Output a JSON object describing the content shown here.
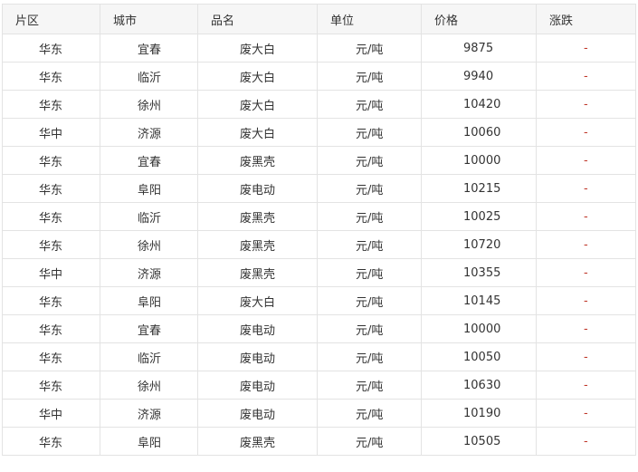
{
  "table": {
    "headers": [
      "片区",
      "城市",
      "品名",
      "单位",
      "价格",
      "涨跌"
    ],
    "rows": [
      [
        "华东",
        "宜春",
        "废大白",
        "元/吨",
        "9875",
        "-"
      ],
      [
        "华东",
        "临沂",
        "废大白",
        "元/吨",
        "9940",
        "-"
      ],
      [
        "华东",
        "徐州",
        "废大白",
        "元/吨",
        "10420",
        "-"
      ],
      [
        "华中",
        "济源",
        "废大白",
        "元/吨",
        "10060",
        "-"
      ],
      [
        "华东",
        "宜春",
        "废黑壳",
        "元/吨",
        "10000",
        "-"
      ],
      [
        "华东",
        "阜阳",
        "废电动",
        "元/吨",
        "10215",
        "-"
      ],
      [
        "华东",
        "临沂",
        "废黑壳",
        "元/吨",
        "10025",
        "-"
      ],
      [
        "华东",
        "徐州",
        "废黑壳",
        "元/吨",
        "10720",
        "-"
      ],
      [
        "华中",
        "济源",
        "废黑壳",
        "元/吨",
        "10355",
        "-"
      ],
      [
        "华东",
        "阜阳",
        "废大白",
        "元/吨",
        "10145",
        "-"
      ],
      [
        "华东",
        "宜春",
        "废电动",
        "元/吨",
        "10000",
        "-"
      ],
      [
        "华东",
        "临沂",
        "废电动",
        "元/吨",
        "10050",
        "-"
      ],
      [
        "华东",
        "徐州",
        "废电动",
        "元/吨",
        "10630",
        "-"
      ],
      [
        "华中",
        "济源",
        "废电动",
        "元/吨",
        "10190",
        "-"
      ],
      [
        "华东",
        "阜阳",
        "废黑壳",
        "元/吨",
        "10505",
        "-"
      ]
    ]
  },
  "colors": {
    "header_bg": "#f6f6f6",
    "border": "#e3e3e3",
    "change_dash": "#c0392b"
  }
}
